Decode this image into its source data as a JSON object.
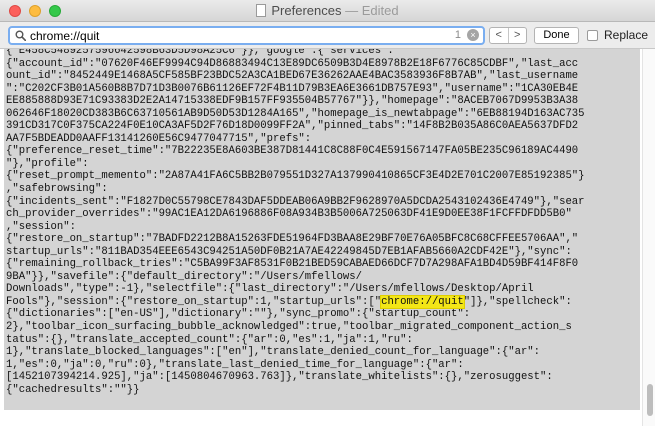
{
  "window": {
    "title": "Preferences",
    "subtitle": "— Edited"
  },
  "findbar": {
    "query": "chrome://quit",
    "match_count": "1",
    "clear_icon": "x-circle",
    "prev_label": "<",
    "next_label": ">",
    "done_label": "Done",
    "replace_label": "Replace",
    "replace_checked": false
  },
  "document": {
    "lines": [
      "{\"account_id\":\"07620F46EF9994C94D86883494C13E89DC6509B3D4E8978B2E18F6776C85CDBF\",\"last_acc",
      "ount_id\":\"8452449E1468A5CF585BF23BDC52A3CA1BED67E36262AAE4BAC3583936F8B7AB\",\"last_username",
      "\":\"C202CF3B01A560B8B7D71D3B0076B61126EF72F4B11D79B3EA6E3661DB757E93\",\"username\":\"1CA30EB4E",
      "EE885888D93E71C93383D2E2A14715338EDF9B157FF935504B57767\"}},\"homepage\":\"8ACEB7067D9953B3A38",
      "062646F18020CD383B6C63710561AB9D50D53D1284A165\",\"homepage_is_newtabpage\":\"6EB88194D163AC735",
      "391CD317C0F375CA224F0E10CA3AF5D2F76D18D0099FF2A\",\"pinned_tabs\":\"14F8B2B035A86C0AEA5637DFD2",
      "AA7F5BDEADD0AAFF13141260E56C9477047715\",\"prefs\":",
      "{\"preference_reset_time\":\"7B22235E8A603BE387D81441C8C88F0C4E591567147FA05BE235C96189AC4490",
      "\"},\"profile\":",
      "{\"reset_prompt_memento\":\"2A87A41FA6C5BB2B079551D327A137990410865CF3E4D2E701C2007E85192385\"}",
      ",\"safebrowsing\":",
      "{\"incidents_sent\":\"F1827D0C55798CE7843DAF5DDEAB06A9BB2F9628970A5DCDA2543102436E4749\"},\"sear",
      "ch_provider_overrides\":\"99AC1EA12DA6196886F08A934B3B5006A725063DF41E9D0EE38F1FCFFDFDD5B0\"",
      ",\"session\":",
      "{\"restore_on_startup\":\"7BADFD2212B8A15263FDE51964FD3BAA8E29BF70E76A05BFC8C68CFFEE5706AA\",\"",
      "startup_urls\":\"811BAD354EEE6543C94251A50DF0B21A7AE42249845D7EB1AFAB5660A2CDF42E\"},\"sync\":",
      "{\"remaining_rollback_tries\":\"C5BA99F3AF8531F0B21BED59CABAED66DCF7D7A298AFA1BD4D59BF414F8F0",
      "9BA\"}},\"savefile\":{\"default_directory\":\"/Users/mfellows/",
      "Downloads\",\"type\":-1},\"selectfile\":{\"last_directory\":\"/Users/mfellows/Desktop/April",
      "Fools\"},\"session\":{\"restore_on_startup\":1,\"startup_urls\":[\"",
      "{\"dictionaries\":[\"en-US\"],\"dictionary\":\"\"},\"sync_promo\":{\"startup_count\":",
      "2},\"toolbar_icon_surfacing_bubble_acknowledged\":true,\"toolbar_migrated_component_action_s",
      "tatus\":{},\"translate_accepted_count\":{\"ar\":0,\"es\":1,\"ja\":1,\"ru\":",
      "1},\"translate_blocked_languages\":[\"en\"],\"translate_denied_count_for_language\":{\"ar\":",
      "1,\"es\":0,\"ja\":0,\"ru\":0},\"translate_last_denied_time_for_language\":{\"ar\":",
      "[1452107394214.925],\"ja\":[1450804670963.763]},\"translate_whitelists\":{},\"zerosuggest\":",
      "{\"cachedresults\":\"\"}}"
    ],
    "line20_highlight": "chrome://quit",
    "line20_tail": "\"]},\"spellcheck\":"
  }
}
